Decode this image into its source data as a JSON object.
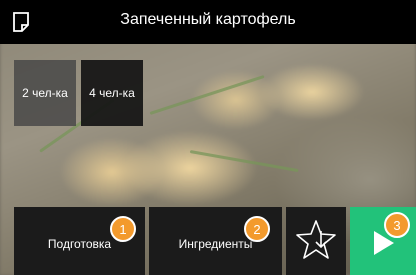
{
  "header": {
    "title": "Запеченный картофель",
    "icon": "document-icon"
  },
  "portions": [
    {
      "label": "2 чел-ка",
      "selected": false
    },
    {
      "label": "4 чел-ка",
      "selected": true
    }
  ],
  "bottom_bar": {
    "preparation_label": "Подготовка",
    "ingredients_label": "Ингредиенты",
    "favorite_icon": "star-download-icon",
    "start_icon": "play-icon"
  },
  "badges": {
    "one": "1",
    "two": "2",
    "three": "3"
  },
  "colors": {
    "accent_green": "#22c27a",
    "badge_orange": "#f39a2d",
    "header_bg": "#000000"
  }
}
